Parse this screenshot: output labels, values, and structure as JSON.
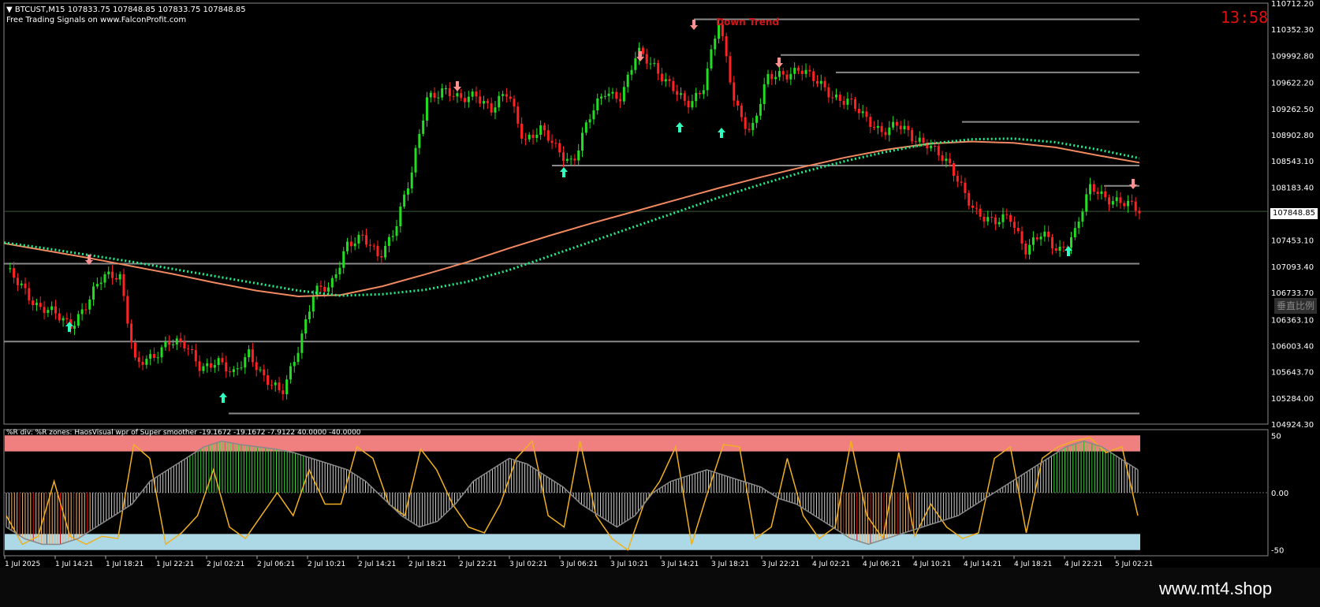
{
  "header": {
    "symbol_line": "BTCUST,M15  107833.75 107848.85 107833.75 107848.85",
    "signals_line": "Free Trading Signals on www.FalconProfit.com",
    "clock": "13:58",
    "trend_label": "Down Trend",
    "axis_button": "垂直比例",
    "current_price": "107848.85"
  },
  "indicator": {
    "title": "%R div: %R zones:  HaosVisual wpr of Super smoother -19.1672 -19.1672 -7.9122 40.0000 -40.0000"
  },
  "watermark": "www.mt4.shop",
  "colors": {
    "bull": "#22dd22",
    "bear": "#ff2222",
    "ma_slow": "#f08860",
    "ma_dots": "#22ee88",
    "level": "#8a8a8a",
    "zone_top": "#f08080",
    "zone_bottom": "#add8e6",
    "wpr": "#f0b020"
  },
  "chart_data": [
    {
      "type": "candlestick",
      "symbol": "BTCUST",
      "timeframe": "M15",
      "y_ticks": [
        "110712.20",
        "110352.30",
        "109992.80",
        "109622.20",
        "109262.50",
        "108902.80",
        "108543.10",
        "108183.40",
        "107848.85",
        "107453.10",
        "107093.40",
        "106733.70",
        "106363.10",
        "106003.40",
        "105643.70",
        "105284.00",
        "104924.30"
      ],
      "ylim": [
        104924.3,
        110712.2
      ],
      "x_ticks": [
        "1 Jul 2025",
        "1 Jul 14:21",
        "1 Jul 18:21",
        "1 Jul 22:21",
        "2 Jul 02:21",
        "2 Jul 06:21",
        "2 Jul 10:21",
        "2 Jul 14:21",
        "2 Jul 18:21",
        "2 Jul 22:21",
        "3 Jul 02:21",
        "3 Jul 06:21",
        "3 Jul 10:21",
        "3 Jul 14:21",
        "3 Jul 18:21",
        "3 Jul 22:21",
        "4 Jul 02:21",
        "4 Jul 06:21",
        "4 Jul 10:21",
        "4 Jul 14:21",
        "4 Jul 18:21",
        "4 Jul 22:21",
        "5 Jul 02:21"
      ],
      "close_path": [
        107010,
        106840,
        106520,
        106420,
        106310,
        106570,
        106950,
        107020,
        105700,
        105830,
        106100,
        105980,
        105710,
        105820,
        105560,
        105940,
        105530,
        105310,
        105980,
        106720,
        106790,
        107420,
        107460,
        107230,
        107630,
        108300,
        109450,
        109520,
        109350,
        109500,
        109230,
        109480,
        108850,
        108950,
        108710,
        108540,
        109100,
        109520,
        109430,
        110020,
        109880,
        109580,
        109280,
        109550,
        110450,
        109320,
        108960,
        109650,
        109730,
        109840,
        109610,
        109460,
        109380,
        109110,
        108980,
        109040,
        108830,
        108820,
        108520,
        108190,
        107840,
        107650,
        107810,
        107320,
        107520,
        107330,
        107540,
        108180,
        108060,
        107948,
        107849
      ],
      "series": [
        {
          "name": "MA slow",
          "values": [
            107410,
            107310,
            107210,
            107100,
            106990,
            106870,
            106760,
            106680,
            106700,
            106820,
            106980,
            107150,
            107340,
            107520,
            107690,
            107850,
            108010,
            108170,
            108320,
            108460,
            108590,
            108700,
            108780,
            108810,
            108790,
            108730,
            108620,
            108520
          ]
        },
        {
          "name": "MA dots",
          "values": [
            107420,
            107340,
            107250,
            107160,
            107060,
            106960,
            106860,
            106760,
            106690,
            106710,
            106770,
            106880,
            107040,
            107240,
            107440,
            107640,
            107840,
            108040,
            108220,
            108390,
            108540,
            108670,
            108780,
            108840,
            108850,
            108800,
            108700,
            108580
          ]
        }
      ],
      "levels": [
        110490,
        110000,
        109760,
        109080,
        108480,
        108200,
        107130,
        106060,
        105070
      ]
    },
    {
      "type": "line",
      "name": "HaosVisual wpr",
      "y_ticks": [
        "50",
        "0.00",
        "-50"
      ],
      "ylim": [
        -55,
        55
      ],
      "zones": [
        40,
        -40
      ],
      "values": {
        "wpr": [
          -20,
          -45,
          -38,
          10,
          -38,
          -45,
          -38,
          -40,
          42,
          30,
          -45,
          -35,
          -20,
          20,
          -30,
          -40,
          -20,
          0,
          -20,
          20,
          -10,
          -10,
          40,
          30,
          -10,
          -20,
          38,
          20,
          -10,
          -30,
          -35,
          -10,
          30,
          45,
          -20,
          -30,
          45,
          -20,
          -40,
          -50,
          -10,
          10,
          40,
          -45,
          0,
          42,
          40,
          -40,
          -30,
          30,
          -20,
          -40,
          -30,
          45,
          -20,
          -40,
          35,
          -38,
          -10,
          -30,
          -40,
          -35,
          30,
          40,
          -35,
          30,
          40,
          45,
          48,
          35,
          40,
          -20
        ],
        "histogram": [
          -30,
          -40,
          -45,
          -45,
          -40,
          -30,
          -20,
          -10,
          10,
          20,
          30,
          40,
          45,
          42,
          40,
          38,
          35,
          30,
          25,
          20,
          10,
          -5,
          -20,
          -30,
          -25,
          -10,
          10,
          20,
          30,
          25,
          15,
          5,
          -10,
          -20,
          -30,
          -20,
          0,
          10,
          15,
          20,
          15,
          10,
          5,
          -5,
          -10,
          -20,
          -30,
          -40,
          -45,
          -40,
          -35,
          -30,
          -25,
          -20,
          -10,
          0,
          10,
          20,
          30,
          40,
          45,
          40,
          30,
          20
        ]
      }
    }
  ]
}
